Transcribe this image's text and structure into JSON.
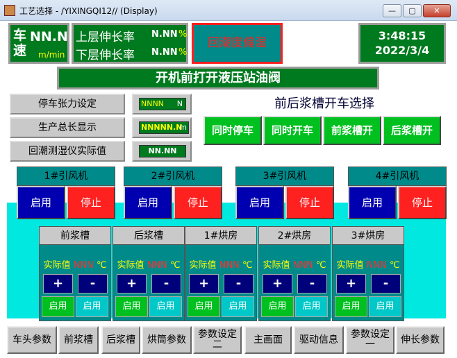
{
  "window": {
    "title": "工艺选择 - /YIXINGQI12// (Display)",
    "min": "—",
    "max": "▢",
    "close": "✕"
  },
  "speed": {
    "label": "车速",
    "value": "NN.N",
    "unit": "m/min"
  },
  "stretch": {
    "upper_label": "上层伸长率",
    "upper_value": "N.NN",
    "lower_label": "下层伸长率",
    "lower_value": "N.NN",
    "unit": "%"
  },
  "alarm": {
    "text": "回潮度偏湿"
  },
  "clock": {
    "time": "3:48:15",
    "date": "2022/3/4"
  },
  "notice": {
    "text": "开机前打开液压站油阀"
  },
  "fields": {
    "tension_label": "停车张力设定",
    "tension_value": "NNNN",
    "tension_unit": "N",
    "length_label": "生产总长显示",
    "length_value": "NNNNN.N",
    "length_unit": "m",
    "humidity_label": "回潮测湿仪实际值",
    "humidity_value": "NN.NN"
  },
  "tank_select": {
    "title": "前后浆槽开车选择",
    "buttons": [
      "同时停车",
      "同时开车",
      "前浆槽开",
      "后浆槽开"
    ]
  },
  "fans": [
    {
      "name": "1#引风机",
      "start": "启用",
      "stop": "停止"
    },
    {
      "name": "2#引风机",
      "start": "启用",
      "stop": "停止"
    },
    {
      "name": "3#引风机",
      "start": "启用",
      "stop": "停止"
    },
    {
      "name": "4#引风机",
      "start": "启用",
      "stop": "停止"
    }
  ],
  "zones": [
    {
      "name": "前浆槽",
      "label": "实际值",
      "value": "NNN",
      "unit": "℃",
      "plus": "+",
      "minus": "-",
      "enable1": "启用",
      "enable2": "启用"
    },
    {
      "name": "后浆槽",
      "label": "实际值",
      "value": "NNN",
      "unit": "℃",
      "plus": "+",
      "minus": "-",
      "enable1": "启用",
      "enable2": "启用"
    },
    {
      "name": "1#烘房",
      "label": "实际值",
      "value": "NNN",
      "unit": "℃",
      "plus": "+",
      "minus": "-",
      "enable1": "启用",
      "enable2": "启用"
    },
    {
      "name": "2#烘房",
      "label": "实际值",
      "value": "NNN",
      "unit": "℃",
      "plus": "+",
      "minus": "-",
      "enable1": "启用",
      "enable2": "启用"
    },
    {
      "name": "3#烘房",
      "label": "实际值",
      "value": "NNN",
      "unit": "℃",
      "plus": "+",
      "minus": "-",
      "enable1": "启用",
      "enable2": "启用"
    }
  ],
  "nav": [
    "车头参数",
    "前浆槽",
    "后浆槽",
    "烘筒参数",
    "参数设定二",
    "主画面",
    "驱动信息",
    "参数设定一",
    "伸长参数"
  ],
  "colors": {
    "panel_green": "#007a1e",
    "teal": "#008a8a",
    "cyan": "#00e8e0",
    "alarm": "#ff2020"
  }
}
